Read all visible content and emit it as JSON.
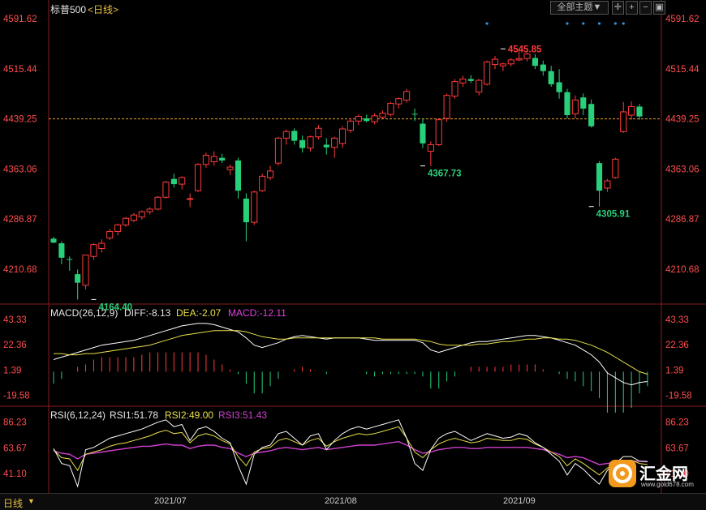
{
  "header": {
    "title": "标普500",
    "period_tag": "<日线>",
    "main_indicator": "全部主题▼"
  },
  "colors": {
    "up": "#ff3b3b",
    "down": "#29d07a",
    "price_axis": "#ff4d4d",
    "last_price_line": "#e8a030",
    "diff_line": "#ffffff",
    "dea_line": "#e8e04a",
    "macd_label": "#e040e0",
    "rsi1": "#ffffff",
    "rsi2": "#e8e04a",
    "rsi3": "#d040d0",
    "signal_dots": "#3a8fd8"
  },
  "bottom_bar": {
    "period_label": "日线",
    "months": [
      "2021/07",
      "2021/08",
      "2021/09"
    ]
  },
  "watermark": {
    "text": "汇金网",
    "url": "www.gold678.com"
  },
  "chart_data": {
    "type": "candlestick",
    "title": "标普500",
    "price_axis": {
      "ticks": [
        "4591.62",
        "4515.44",
        "4439.25",
        "4363.06",
        "4286.87",
        "4210.68"
      ],
      "ylim": [
        4157.5,
        4598
      ]
    },
    "last_price": 4439.25,
    "annotations": [
      {
        "label": "4164.40",
        "value": 4164.4,
        "bar": 5
      },
      {
        "label": "4367.73",
        "value": 4367.73,
        "bar": 46
      },
      {
        "label": "4545.85",
        "value": 4545.85,
        "bar": 56
      },
      {
        "label": "4305.91",
        "value": 4305.91,
        "bar": 67
      }
    ],
    "signal_dot_bars": [
      54,
      64,
      66,
      68,
      70,
      71
    ],
    "candles": [
      {
        "o": 4257,
        "h": 4260,
        "l": 4250,
        "c": 4251
      },
      {
        "o": 4250,
        "h": 4253,
        "l": 4218,
        "c": 4228
      },
      {
        "o": 4226,
        "h": 4230,
        "l": 4208,
        "c": 4225
      },
      {
        "o": 4203,
        "h": 4210,
        "l": 4164.4,
        "c": 4190
      },
      {
        "o": 4186,
        "h": 4232,
        "l": 4180,
        "c": 4232
      },
      {
        "o": 4230,
        "h": 4250,
        "l": 4225,
        "c": 4248
      },
      {
        "o": 4242,
        "h": 4256,
        "l": 4236,
        "c": 4250
      },
      {
        "o": 4258,
        "h": 4272,
        "l": 4255,
        "c": 4268
      },
      {
        "o": 4268,
        "h": 4280,
        "l": 4262,
        "c": 4278
      },
      {
        "o": 4278,
        "h": 4290,
        "l": 4275,
        "c": 4288
      },
      {
        "o": 4285,
        "h": 4296,
        "l": 4282,
        "c": 4293
      },
      {
        "o": 4290,
        "h": 4300,
        "l": 4286,
        "c": 4298
      },
      {
        "o": 4298,
        "h": 4305,
        "l": 4294,
        "c": 4302
      },
      {
        "o": 4302,
        "h": 4322,
        "l": 4300,
        "c": 4320
      },
      {
        "o": 4320,
        "h": 4345,
        "l": 4318,
        "c": 4343
      },
      {
        "o": 4348,
        "h": 4356,
        "l": 4335,
        "c": 4340
      },
      {
        "o": 4340,
        "h": 4352,
        "l": 4332,
        "c": 4350
      },
      {
        "o": 4318,
        "h": 4326,
        "l": 4305,
        "c": 4318
      },
      {
        "o": 4330,
        "h": 4372,
        "l": 4328,
        "c": 4370
      },
      {
        "o": 4370,
        "h": 4388,
        "l": 4365,
        "c": 4384
      },
      {
        "o": 4374,
        "h": 4390,
        "l": 4368,
        "c": 4382
      },
      {
        "o": 4380,
        "h": 4386,
        "l": 4372,
        "c": 4376
      },
      {
        "o": 4362,
        "h": 4370,
        "l": 4354,
        "c": 4366
      },
      {
        "o": 4376,
        "h": 4380,
        "l": 4318,
        "c": 4330
      },
      {
        "o": 4318,
        "h": 4326,
        "l": 4253,
        "c": 4282
      },
      {
        "o": 4282,
        "h": 4330,
        "l": 4278,
        "c": 4328
      },
      {
        "o": 4330,
        "h": 4356,
        "l": 4328,
        "c": 4352
      },
      {
        "o": 4350,
        "h": 4368,
        "l": 4346,
        "c": 4360
      },
      {
        "o": 4372,
        "h": 4412,
        "l": 4368,
        "c": 4410
      },
      {
        "o": 4410,
        "h": 4423,
        "l": 4400,
        "c": 4420
      },
      {
        "o": 4421,
        "h": 4425,
        "l": 4400,
        "c": 4406
      },
      {
        "o": 4407,
        "h": 4414,
        "l": 4388,
        "c": 4395
      },
      {
        "o": 4395,
        "h": 4414,
        "l": 4390,
        "c": 4412
      },
      {
        "o": 4412,
        "h": 4430,
        "l": 4408,
        "c": 4425
      },
      {
        "o": 4400,
        "h": 4410,
        "l": 4385,
        "c": 4396
      },
      {
        "o": 4396,
        "h": 4412,
        "l": 4380,
        "c": 4410
      },
      {
        "o": 4402,
        "h": 4428,
        "l": 4395,
        "c": 4424
      },
      {
        "o": 4422,
        "h": 4440,
        "l": 4418,
        "c": 4436
      },
      {
        "o": 4436,
        "h": 4446,
        "l": 4430,
        "c": 4443
      },
      {
        "o": 4440,
        "h": 4446,
        "l": 4434,
        "c": 4436
      },
      {
        "o": 4435,
        "h": 4448,
        "l": 4431,
        "c": 4444
      },
      {
        "o": 4442,
        "h": 4452,
        "l": 4440,
        "c": 4448
      },
      {
        "o": 4446,
        "h": 4465,
        "l": 4443,
        "c": 4463
      },
      {
        "o": 4462,
        "h": 4472,
        "l": 4455,
        "c": 4470
      },
      {
        "o": 4468,
        "h": 4485,
        "l": 4464,
        "c": 4481
      },
      {
        "o": 4447,
        "h": 4455,
        "l": 4436,
        "c": 4446
      },
      {
        "o": 4432,
        "h": 4440,
        "l": 4395,
        "c": 4402
      },
      {
        "o": 4390,
        "h": 4405,
        "l": 4367.73,
        "c": 4400
      },
      {
        "o": 4400,
        "h": 4440,
        "l": 4398,
        "c": 4438
      },
      {
        "o": 4440,
        "h": 4478,
        "l": 4435,
        "c": 4475
      },
      {
        "o": 4474,
        "h": 4500,
        "l": 4470,
        "c": 4496
      },
      {
        "o": 4494,
        "h": 4505,
        "l": 4488,
        "c": 4500
      },
      {
        "o": 4500,
        "h": 4506,
        "l": 4494,
        "c": 4497
      },
      {
        "o": 4480,
        "h": 4500,
        "l": 4475,
        "c": 4498
      },
      {
        "o": 4492,
        "h": 4528,
        "l": 4490,
        "c": 4526
      },
      {
        "o": 4522,
        "h": 4535,
        "l": 4515,
        "c": 4530
      },
      {
        "o": 4520,
        "h": 4525,
        "l": 4512,
        "c": 4523
      },
      {
        "o": 4523,
        "h": 4532,
        "l": 4519,
        "c": 4529
      },
      {
        "o": 4529,
        "h": 4545.85,
        "l": 4527,
        "c": 4531
      },
      {
        "o": 4531,
        "h": 4540,
        "l": 4527,
        "c": 4538
      },
      {
        "o": 4532,
        "h": 4538,
        "l": 4515,
        "c": 4520
      },
      {
        "o": 4522,
        "h": 4528,
        "l": 4505,
        "c": 4512
      },
      {
        "o": 4512,
        "h": 4520,
        "l": 4488,
        "c": 4492
      },
      {
        "o": 4495,
        "h": 4515,
        "l": 4470,
        "c": 4480
      },
      {
        "o": 4480,
        "h": 4485,
        "l": 4440,
        "c": 4445
      },
      {
        "o": 4447,
        "h": 4475,
        "l": 4440,
        "c": 4468
      },
      {
        "o": 4472,
        "h": 4478,
        "l": 4445,
        "c": 4455
      },
      {
        "o": 4462,
        "h": 4469,
        "l": 4426,
        "c": 4428
      },
      {
        "o": 4372,
        "h": 4375,
        "l": 4305.91,
        "c": 4330
      },
      {
        "o": 4334,
        "h": 4348,
        "l": 4328,
        "c": 4345
      },
      {
        "o": 4350,
        "h": 4380,
        "l": 4348,
        "c": 4378
      },
      {
        "o": 4420,
        "h": 4465,
        "l": 4418,
        "c": 4450
      },
      {
        "o": 4445,
        "h": 4466,
        "l": 4438,
        "c": 4458
      },
      {
        "o": 4458,
        "h": 4462,
        "l": 4438,
        "c": 4443
      }
    ],
    "macd": {
      "label": "MACD(26,12,9)",
      "diff_label": "DIFF:-8.13",
      "dea_label": "DEA:-2.07",
      "macd_label": "MACD:-12.11",
      "ticks": [
        "43.33",
        "22.36",
        "1.39",
        "-19.58"
      ],
      "ylim": [
        -28,
        46
      ],
      "diff": [
        10,
        12,
        14,
        16,
        18,
        20,
        22,
        23,
        24,
        25,
        26,
        28,
        30,
        32,
        34,
        36,
        38,
        39,
        40,
        40,
        39,
        37,
        35,
        33,
        28,
        22,
        20,
        22,
        24,
        27,
        29,
        30,
        29,
        28,
        27,
        28,
        28,
        28,
        28,
        27,
        26,
        26,
        26,
        26,
        26,
        26,
        24,
        18,
        16,
        18,
        20,
        22,
        24,
        25,
        25,
        26,
        27,
        28,
        29,
        30,
        30,
        29,
        28,
        26,
        24,
        22,
        18,
        14,
        8,
        -1,
        -5,
        -9,
        -11,
        -9,
        -8.13
      ],
      "dea": [
        15,
        15,
        14,
        14,
        15,
        15,
        16,
        17,
        18,
        19,
        20,
        21,
        22,
        24,
        26,
        28,
        30,
        31,
        32,
        33,
        34,
        34,
        34,
        34,
        33,
        31,
        29,
        28,
        27,
        27,
        28,
        28,
        28,
        28,
        28,
        28,
        28,
        28,
        28,
        28,
        28,
        27,
        27,
        27,
        27,
        27,
        26,
        25,
        23,
        22,
        22,
        22,
        22,
        23,
        23,
        24,
        25,
        25,
        26,
        27,
        27,
        28,
        28,
        27,
        27,
        26,
        24,
        22,
        19,
        16,
        12,
        8,
        4,
        0,
        -2.07
      ]
    },
    "rsi": {
      "label": "RSI(6,12,24)",
      "rsi1_label": "RSI1:51.78",
      "rsi2_label": "RSI2:49.00",
      "rsi3_label": "RSI3:51.43",
      "ticks": [
        "86.23",
        "63.67",
        "41.10"
      ],
      "ylim": [
        25,
        90
      ],
      "rsi1": [
        63,
        50,
        48,
        30,
        62,
        64,
        68,
        72,
        74,
        76,
        78,
        80,
        83,
        86,
        88,
        82,
        84,
        70,
        80,
        82,
        78,
        72,
        68,
        48,
        32,
        58,
        64,
        66,
        76,
        78,
        72,
        66,
        74,
        76,
        62,
        70,
        76,
        80,
        82,
        80,
        82,
        84,
        86,
        88,
        72,
        50,
        44,
        62,
        72,
        76,
        78,
        74,
        70,
        73,
        76,
        74,
        72,
        73,
        76,
        74,
        68,
        64,
        58,
        52,
        40,
        50,
        45,
        38,
        32,
        44,
        50,
        56,
        56,
        52,
        51.78
      ],
      "rsi2": [
        62,
        55,
        54,
        44,
        58,
        60,
        62,
        65,
        67,
        68,
        70,
        72,
        74,
        77,
        79,
        76,
        77,
        68,
        74,
        76,
        74,
        70,
        67,
        56,
        48,
        60,
        63,
        64,
        70,
        72,
        69,
        66,
        70,
        72,
        65,
        69,
        72,
        74,
        76,
        75,
        76,
        78,
        80,
        82,
        72,
        60,
        55,
        62,
        67,
        70,
        72,
        70,
        68,
        69,
        72,
        71,
        70,
        70,
        72,
        71,
        67,
        64,
        60,
        56,
        48,
        54,
        50,
        45,
        40,
        46,
        49,
        52,
        53,
        50,
        49
      ],
      "rsi3": [
        61,
        59,
        58,
        54,
        58,
        59,
        60,
        61,
        62,
        63,
        64,
        65,
        65,
        66,
        67,
        66,
        66,
        63,
        65,
        66,
        66,
        64,
        63,
        59,
        56,
        59,
        60,
        61,
        63,
        64,
        63,
        62,
        63,
        64,
        62,
        63,
        64,
        65,
        66,
        66,
        66,
        67,
        68,
        69,
        66,
        62,
        59,
        60,
        62,
        63,
        64,
        64,
        63,
        63,
        64,
        64,
        64,
        64,
        64,
        64,
        63,
        62,
        60,
        58,
        55,
        56,
        55,
        52,
        49,
        50,
        51,
        52,
        52,
        52,
        51.43
      ]
    }
  }
}
